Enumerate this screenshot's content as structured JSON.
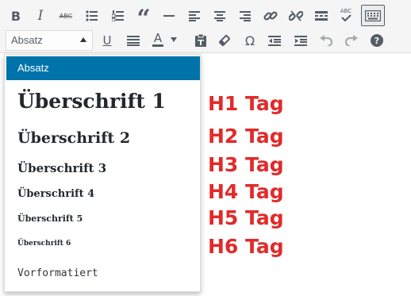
{
  "toolbar": {
    "row1": [
      {
        "name": "bold-button",
        "icon": "bold-icon",
        "glyph": "B"
      },
      {
        "name": "italic-button",
        "icon": "italic-icon",
        "glyph": "I"
      },
      {
        "name": "strikethrough-button",
        "icon": "strikethrough-icon",
        "glyph": "ABC"
      },
      {
        "name": "bullet-list-button",
        "icon": "bullet-list-icon"
      },
      {
        "name": "numbered-list-button",
        "icon": "numbered-list-icon"
      },
      {
        "name": "blockquote-button",
        "icon": "quote-icon",
        "glyph": "“"
      },
      {
        "name": "horizontal-line-button",
        "icon": "horizontal-line-icon"
      },
      {
        "name": "align-left-button",
        "icon": "align-left-icon"
      },
      {
        "name": "align-center-button",
        "icon": "align-center-icon"
      },
      {
        "name": "align-right-button",
        "icon": "align-right-icon"
      },
      {
        "name": "insert-link-button",
        "icon": "link-icon"
      },
      {
        "name": "remove-link-button",
        "icon": "unlink-icon"
      },
      {
        "name": "read-more-button",
        "icon": "read-more-icon"
      },
      {
        "name": "spellcheck-button",
        "icon": "spellcheck-icon",
        "glyph": "ABC"
      },
      {
        "name": "toolbar-toggle-button",
        "icon": "keyboard-icon",
        "active": true
      }
    ],
    "row2": [
      {
        "name": "underline-button",
        "icon": "underline-icon",
        "glyph": "U"
      },
      {
        "name": "justify-button",
        "icon": "justify-icon"
      },
      {
        "name": "text-color-button",
        "icon": "text-color-icon",
        "glyph": "A"
      },
      {
        "name": "paste-as-text-button",
        "icon": "paste-icon"
      },
      {
        "name": "clear-formatting-button",
        "icon": "eraser-icon"
      },
      {
        "name": "special-character-button",
        "icon": "omega-icon",
        "glyph": "Ω"
      },
      {
        "name": "outdent-button",
        "icon": "outdent-icon"
      },
      {
        "name": "indent-button",
        "icon": "indent-icon"
      },
      {
        "name": "undo-button",
        "icon": "undo-icon",
        "disabled": true
      },
      {
        "name": "redo-button",
        "icon": "redo-icon",
        "disabled": true
      },
      {
        "name": "help-button",
        "icon": "help-icon",
        "glyph": "?"
      }
    ]
  },
  "format_select": {
    "value": "Absatz"
  },
  "format_menu": {
    "items": [
      {
        "label": "Absatz",
        "selected": true
      },
      {
        "label": "Überschrift 1"
      },
      {
        "label": "Überschrift 2"
      },
      {
        "label": "Überschrift 3"
      },
      {
        "label": "Überschrift 4"
      },
      {
        "label": "Überschrift 5"
      },
      {
        "label": "Überschrift 6"
      },
      {
        "label": "Vorformatiert"
      }
    ]
  },
  "annotations": {
    "h1": "H1 Tag",
    "h2": "H2 Tag",
    "h3": "H3 Tag",
    "h4": "H4 Tag",
    "h5": "H5 Tag",
    "h6": "H6 Tag"
  },
  "colors": {
    "selected_bg": "#0073aa",
    "annotation": "#e22a2a",
    "icon": "#555d66",
    "icon_disabled": "#a7aaad"
  }
}
